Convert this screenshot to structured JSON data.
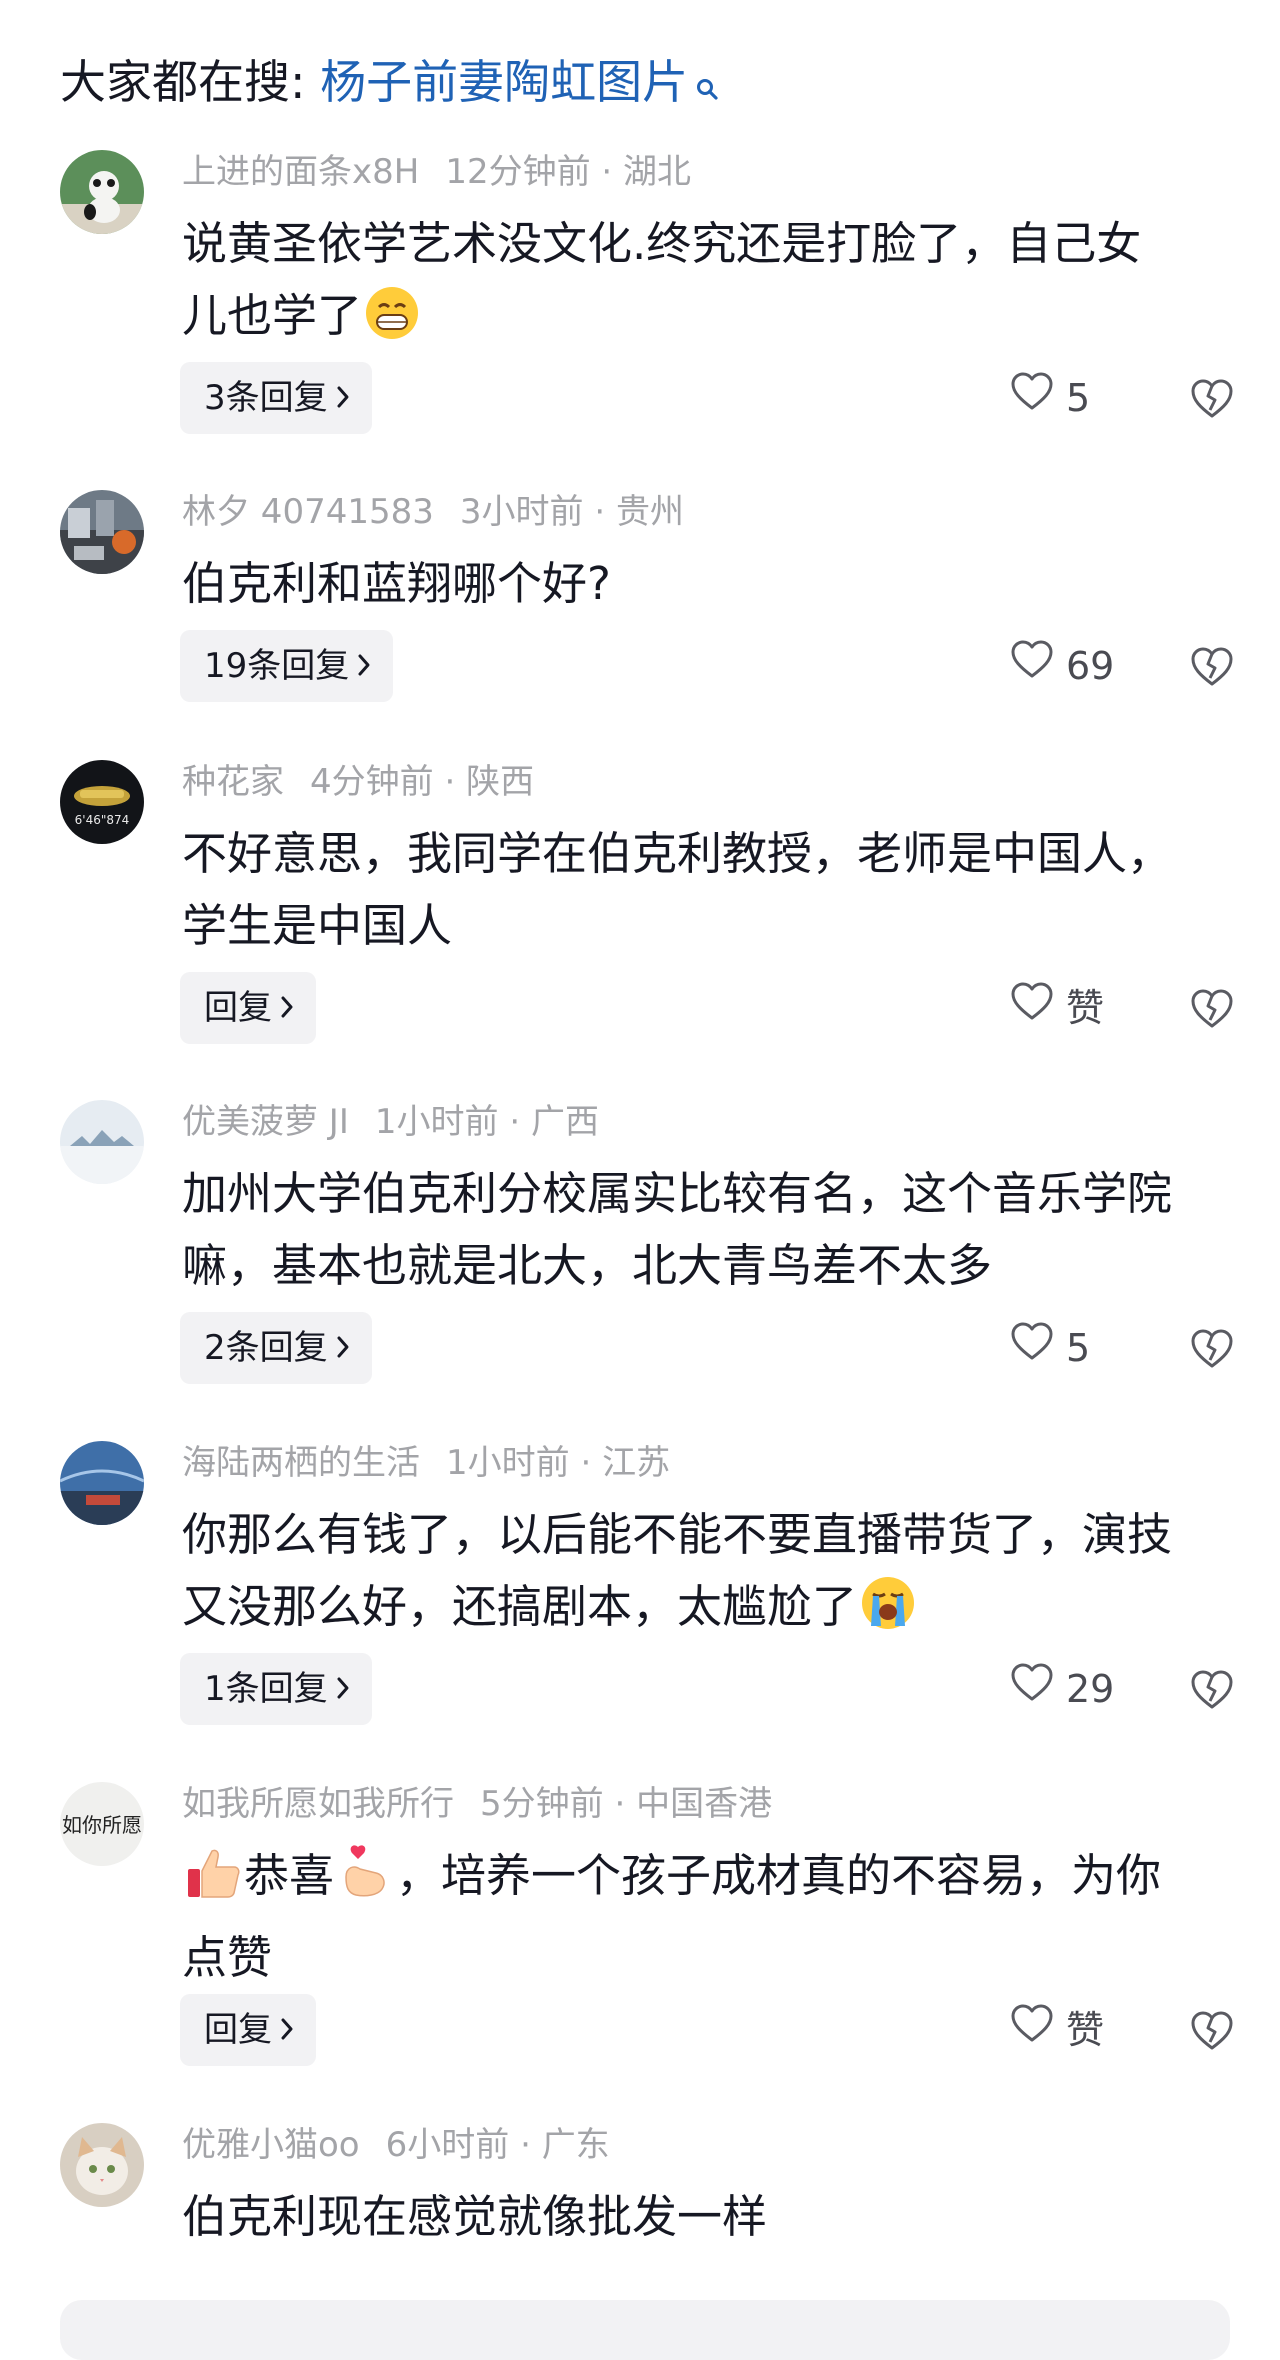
{
  "search_hint": {
    "prefix": "大家都在搜: ",
    "term": "杨子前妻陶虹图片"
  },
  "comments": [
    {
      "user": "上进的面条x8H",
      "time": "12分钟前",
      "location": "湖北",
      "text_lines": [
        "说黄圣依学艺术没文化.终究还是打脸了，自己女",
        "儿也学了"
      ],
      "emoji_end": "grin",
      "reply_label": "3条回复",
      "likes": "5"
    },
    {
      "user": "林夕 40741583",
      "time": "3小时前",
      "location": "贵州",
      "text_lines": [
        "伯克利和蓝翔哪个好?"
      ],
      "reply_label": "19条回复",
      "likes": "69"
    },
    {
      "user": "种花家",
      "time": "4分钟前",
      "location": "陕西",
      "text_lines": [
        "不好意思，我同学在伯克利教授，老师是中国人，",
        "学生是中国人"
      ],
      "reply_label": "回复",
      "likes": "赞",
      "avatar_text": "6'46\"874"
    },
    {
      "user": "优美菠萝 JI",
      "time": "1小时前",
      "location": "广西",
      "text_lines": [
        "加州大学伯克利分校属实比较有名，这个音乐学院",
        "嘛，基本也就是北大，北大青鸟差不太多"
      ],
      "reply_label": "2条回复",
      "likes": "5"
    },
    {
      "user": "海陆两栖的生活",
      "time": "1小时前",
      "location": "江苏",
      "text_lines": [
        "你那么有钱了，以后能不能不要直播带货了，演技",
        "又没那么好，还搞剧本，太尴尬了"
      ],
      "emoji_end": "cry",
      "reply_label": "1条回复",
      "likes": "29"
    },
    {
      "user": "如我所愿如我所行",
      "time": "5分钟前",
      "location": "中国香港",
      "text_parts": [
        "恭喜",
        "，培养一个孩子成材真的不容易，为你"
      ],
      "text_line2": "点赞",
      "reply_label": "回复",
      "likes": "赞",
      "avatar_text": "如你所愿"
    },
    {
      "user": "优雅小猫oo",
      "time": "6小时前",
      "location": "广东",
      "text_lines": [
        "伯克利现在感觉就像批发一样"
      ]
    }
  ],
  "separator": "·"
}
